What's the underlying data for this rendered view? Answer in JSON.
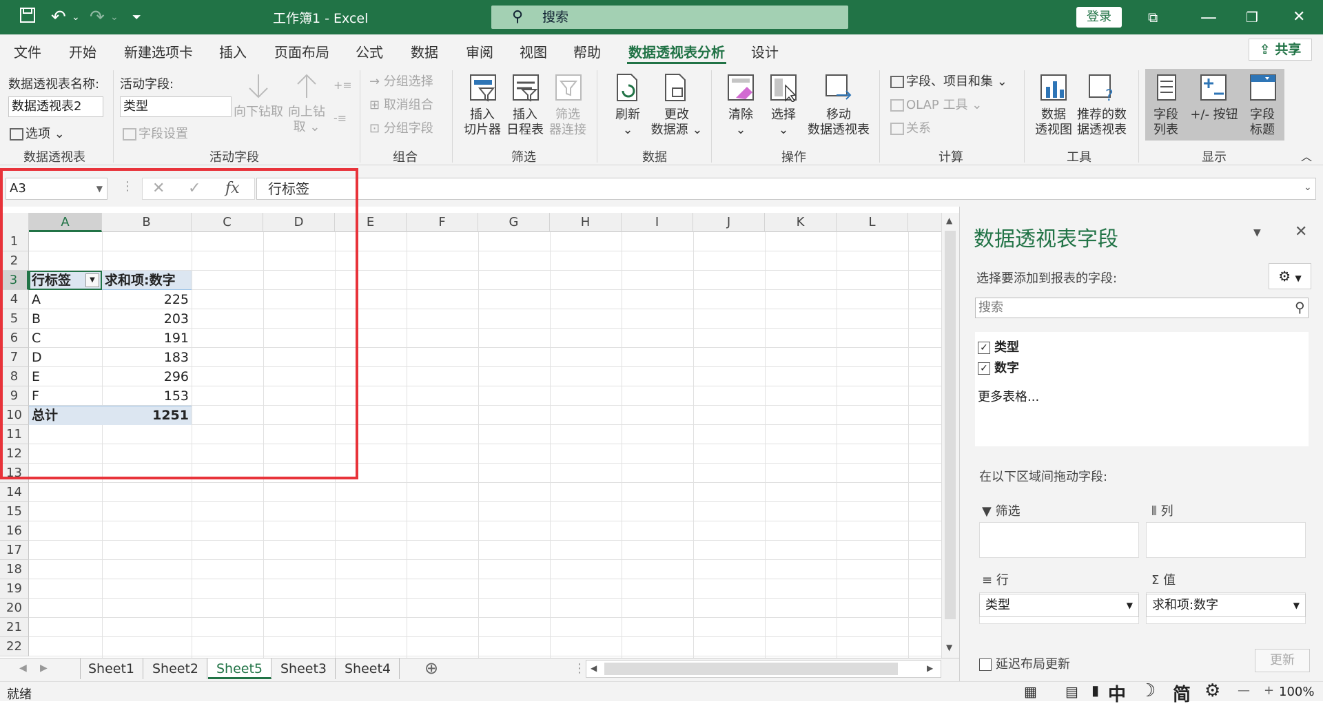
{
  "titlebar": {
    "title": "工作簿1  -  Excel",
    "search": "搜索",
    "login": "登录"
  },
  "menu": {
    "tabs": [
      "文件",
      "开始",
      "新建选项卡",
      "插入",
      "页面布局",
      "公式",
      "数据",
      "审阅",
      "视图",
      "帮助",
      "数据透视表分析",
      "设计"
    ],
    "active_tab": "数据透视表分析",
    "share": "共享"
  },
  "ribbon": {
    "pivot_name_label": "数据透视表名称:",
    "pivot_name_value": "数据透视表2",
    "options": "选项",
    "group_pivot": "数据透视表",
    "active_field_label": "活动字段:",
    "active_field_value": "类型",
    "field_settings": "字段设置",
    "drill_down": "向下钻取",
    "drill_up_1": "向上钻",
    "drill_up_2": "取",
    "group_active_field": "活动字段",
    "group_selection": "分组选择",
    "ungroup": "取消组合",
    "group_field": "分组字段",
    "group_group": "组合",
    "insert_slicer_1": "插入",
    "insert_slicer_2": "切片器",
    "insert_timeline_1": "插入",
    "insert_timeline_2": "日程表",
    "filter_conn_1": "筛选",
    "filter_conn_2": "器连接",
    "group_filter": "筛选",
    "refresh": "刷新",
    "change_source_1": "更改",
    "change_source_2": "数据源",
    "group_data": "数据",
    "clear": "清除",
    "select": "选择",
    "move_1": "移动",
    "move_2": "数据透视表",
    "group_actions": "操作",
    "fields_items": "字段、项目和集",
    "olap": "OLAP 工具",
    "relations": "关系",
    "group_calc": "计算",
    "pivot_chart_1": "数据",
    "pivot_chart_2": "透视图",
    "recommended_1": "推荐的数",
    "recommended_2": "据透视表",
    "group_tools": "工具",
    "field_list_1": "字段",
    "field_list_2": "列表",
    "plus_minus": "+/- 按钮",
    "field_headers_1": "字段",
    "field_headers_2": "标题",
    "group_show": "显示"
  },
  "formula": {
    "namebox": "A3",
    "value": "行标签"
  },
  "grid": {
    "columns": [
      "A",
      "B",
      "C",
      "D",
      "E",
      "F",
      "G",
      "H",
      "I",
      "J",
      "K",
      "L"
    ],
    "rows": [
      "1",
      "2",
      "3",
      "4",
      "5",
      "6",
      "7",
      "8",
      "9",
      "10",
      "11",
      "12",
      "13",
      "14",
      "15",
      "16",
      "17",
      "18",
      "19",
      "20",
      "21",
      "22"
    ],
    "pivot": {
      "header_row_label": "行标签",
      "header_value": "求和项:数字",
      "items": [
        {
          "label": "A",
          "value": "225"
        },
        {
          "label": "B",
          "value": "203"
        },
        {
          "label": "C",
          "value": "191"
        },
        {
          "label": "D",
          "value": "183"
        },
        {
          "label": "E",
          "value": "296"
        },
        {
          "label": "F",
          "value": "153"
        }
      ],
      "total_label": "总计",
      "total_value": "1251"
    }
  },
  "sheets": [
    "Sheet1",
    "Sheet2",
    "Sheet5",
    "Sheet3",
    "Sheet4"
  ],
  "active_sheet": "Sheet5",
  "status": {
    "ready": "就绪",
    "zoom": "100%",
    "ime_1": "中",
    "ime_2": "简"
  },
  "pane": {
    "title": "数据透视表字段",
    "choose_label": "选择要添加到报表的字段:",
    "search_placeholder": "搜索",
    "fields": [
      {
        "name": "类型",
        "checked": true
      },
      {
        "name": "数字",
        "checked": true
      }
    ],
    "more_tables": "更多表格...",
    "drag_label": "在以下区域间拖动字段:",
    "zone_filter": "筛选",
    "zone_columns": "列",
    "zone_rows": "行",
    "zone_values": "值",
    "row_item": "类型",
    "value_item": "求和项:数字",
    "defer_update": "延迟布局更新",
    "update": "更新"
  },
  "colors": {
    "accent": "#217346",
    "highlight_box": "#e8333a",
    "pivot_header": "#dce6f1"
  }
}
